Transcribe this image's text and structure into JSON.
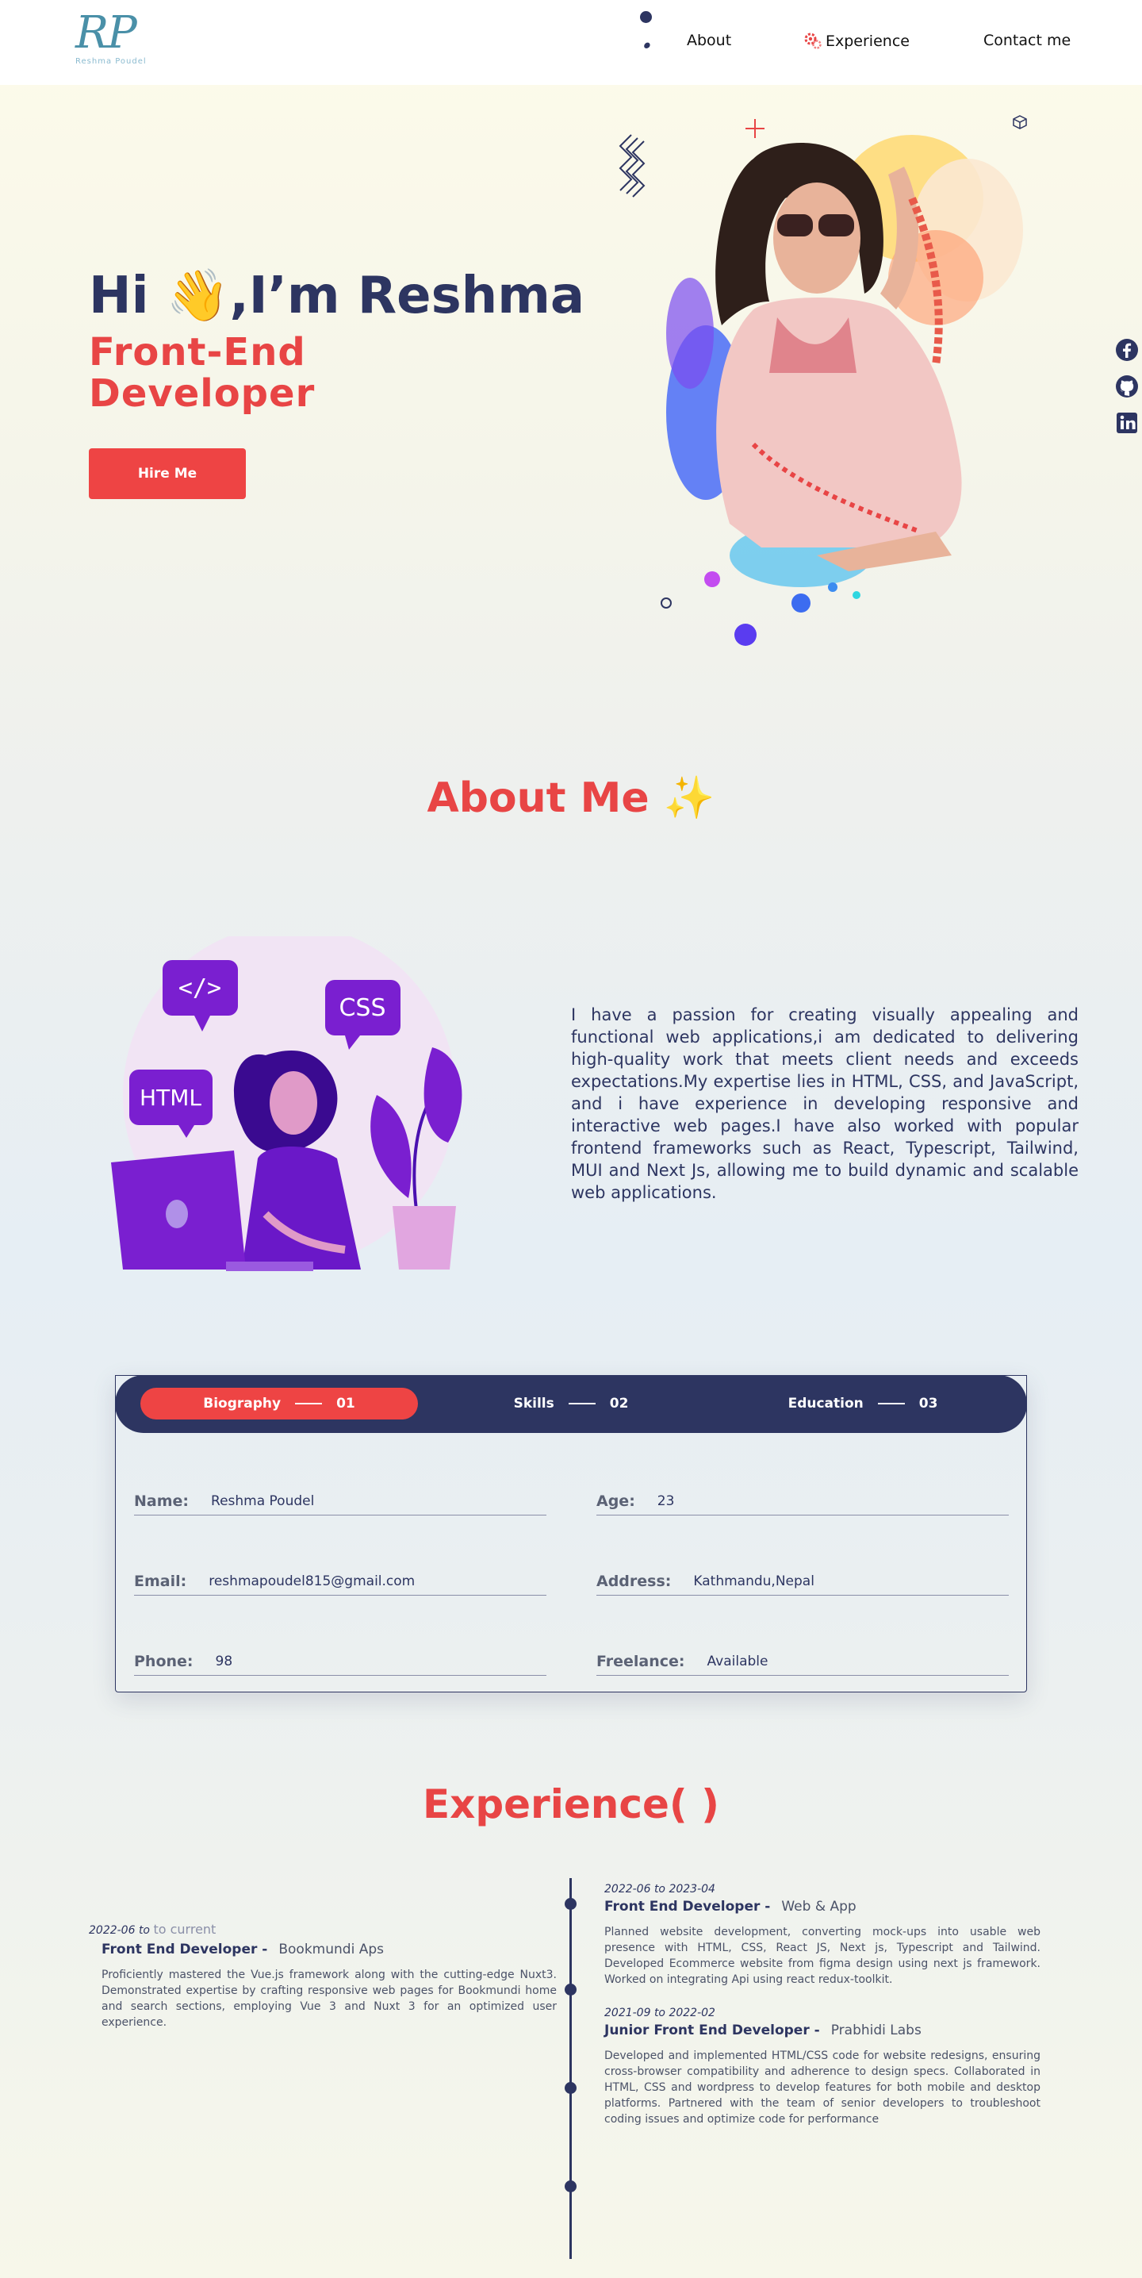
{
  "nav": {
    "logo_text": "RP",
    "logo_subtitle": "Reshma Poudel",
    "links": [
      "About",
      "Experience",
      "Contact me"
    ]
  },
  "hero": {
    "greeting": "Hi 👋,I’m Reshma",
    "role": "Front-End Developer",
    "cta": "Hire Me"
  },
  "social": [
    "facebook-icon",
    "github-icon",
    "linkedin-icon"
  ],
  "about": {
    "title": "About Me ✨",
    "text": "I have a passion for creating visually appealing and functional web applications,i am dedicated to delivering high-quality work that meets client needs and exceeds expectations.My expertise lies in HTML, CSS, and JavaScript, and i have experience in developing responsive and interactive web pages.I have also worked with popular frontend frameworks such as React, Typescript, Tailwind, MUI and Next Js, allowing me to build dynamic and scalable web applications.",
    "illustration_labels": [
      "</>",
      "CSS",
      "HTML"
    ]
  },
  "tabs": [
    {
      "label": "Biography",
      "num": "01"
    },
    {
      "label": "Skills",
      "num": "02"
    },
    {
      "label": "Education",
      "num": "03"
    }
  ],
  "bio": {
    "name_label": "Name:",
    "name": "Reshma Poudel",
    "age_label": "Age:",
    "age": "23",
    "email_label": "Email:",
    "email": "reshmapoudel815@gmail.com",
    "address_label": "Address:",
    "address": "Kathmandu,Nepal",
    "phone_label": "Phone:",
    "phone": "98",
    "freelance_label": "Freelance:",
    "freelance": "Available"
  },
  "experience": {
    "title": "Experience( )",
    "items": [
      {
        "date": "2022-06 to",
        "date_end": "to current",
        "role": "Front End Developer -",
        "company": "Bookmundi Aps",
        "desc": "Proficiently mastered the Vue.js framework along with the cutting-edge Nuxt3. Demonstrated expertise by crafting responsive web pages for Bookmundi home and search sections, employing Vue 3 and Nuxt 3 for an optimized user experience."
      },
      {
        "date": "2022-06 to 2023-04",
        "role": "Front End Developer -",
        "company": "Web & App",
        "desc": "Planned website development, converting mock-ups into usable web presence with HTML, CSS, React JS, Next js, Typescript and Tailwind. Developed Ecommerce website from figma design using next js framework. Worked on integrating Api using react redux-toolkit."
      },
      {
        "date": "2021-09 to 2022-02",
        "role": "Junior Front End Developer -",
        "company": "Prabhidi Labs",
        "desc": "Developed and implemented HTML/CSS code for website redesigns, ensuring cross-browser compatibility and adherence to design specs. Collaborated in HTML, CSS and wordpress to develop features for both mobile and desktop platforms. Partnered with the team of senior developers to troubleshoot coding issues and optimize code for performance"
      }
    ]
  }
}
